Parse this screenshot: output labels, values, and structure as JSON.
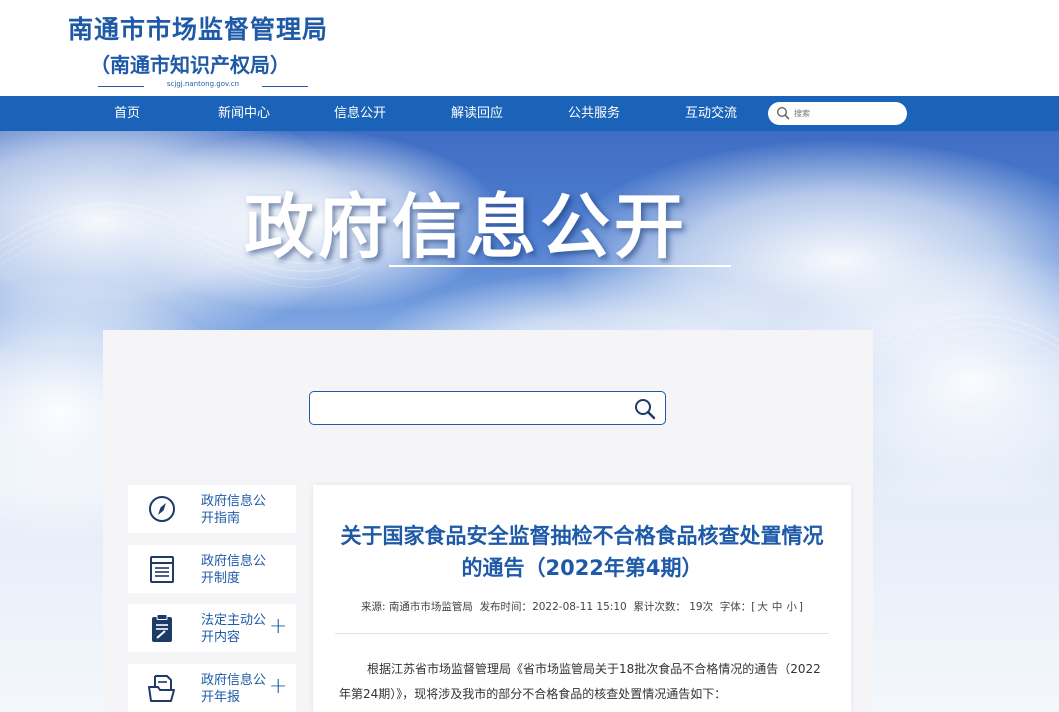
{
  "header": {
    "org_name": "南通市市场监督管理局",
    "org_alias": "（南通市知识产权局）",
    "url": "scjgj.nantong.gov.cn"
  },
  "nav": {
    "items": [
      {
        "label": "首页"
      },
      {
        "label": "新闻中心"
      },
      {
        "label": "信息公开"
      },
      {
        "label": "解读回应"
      },
      {
        "label": "公共服务"
      },
      {
        "label": "互动交流"
      }
    ],
    "search_placeholder": "搜索"
  },
  "banner": {
    "title": "政府信息公开"
  },
  "main_search": {
    "value": ""
  },
  "sidebar": {
    "items": [
      {
        "label": "政府信息公开指南",
        "icon": "compass-icon",
        "expandable": false
      },
      {
        "label": "政府信息公开制度",
        "icon": "document-list-icon",
        "expandable": false
      },
      {
        "label": "法定主动公开内容",
        "icon": "clipboard-edit-icon",
        "expandable": true
      },
      {
        "label": "政府信息公开年报",
        "icon": "file-folder-icon",
        "expandable": true
      }
    ],
    "expand_symbol": "+"
  },
  "article": {
    "title": "关于国家食品安全监督抽检不合格食品核查处置情况的通告（2022年第4期）",
    "meta": {
      "source_label": "来源:",
      "source": "南通市市场监管局",
      "publish_label": "发布时间：",
      "publish_time": "2022-08-11 15:10",
      "views_label": "累计次数：",
      "views": "19次",
      "font_label": "字体：[",
      "font_large": "大",
      "font_medium": "中",
      "font_small": "小",
      "font_close": "]"
    },
    "body": "根据江苏省市场监督管理局《省市场监管局关于18批次食品不合格情况的通告（2022年第24期）》，现将涉及我市的部分不合格食品的核查处置情况通告如下："
  },
  "colors": {
    "brand_blue": "#1e5aa8",
    "nav_blue": "#1b63b8",
    "panel_bg": "#f5f5f7"
  }
}
